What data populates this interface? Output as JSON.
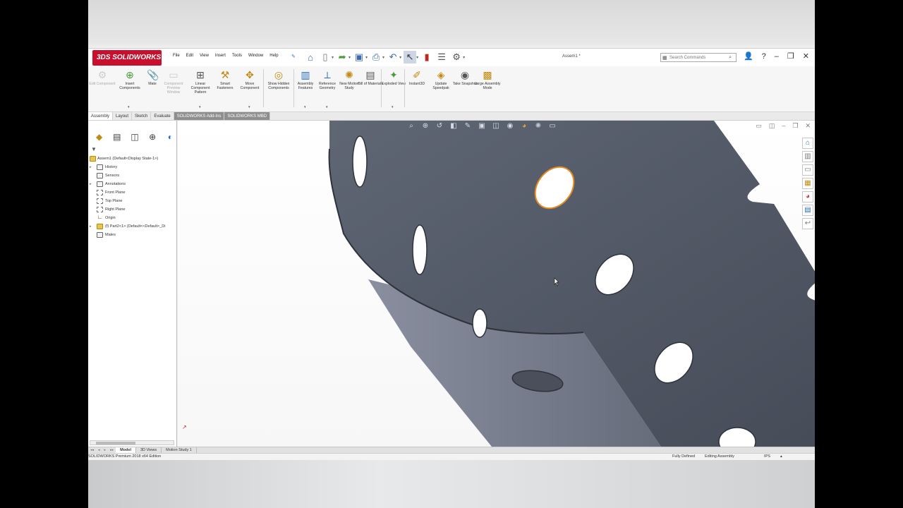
{
  "app": {
    "logo_text": "3DS SOLIDWORKS",
    "document_title": "Assem1 *",
    "accent_color": "#c8102e"
  },
  "menu": [
    "File",
    "Edit",
    "View",
    "Insert",
    "Tools",
    "Window",
    "Help"
  ],
  "quick_access_icons": [
    "home-icon",
    "new-document-icon",
    "open-icon",
    "save-icon",
    "print-icon",
    "undo-icon",
    "select-icon",
    "traffic-light-icon",
    "file-properties-icon",
    "options-gear-icon"
  ],
  "search": {
    "placeholder": "Search Commands"
  },
  "ribbon": {
    "buttons": [
      {
        "label": "Edit Component",
        "enabled": false
      },
      {
        "label": "Insert Components",
        "enabled": true
      },
      {
        "label": "Mate",
        "enabled": true
      },
      {
        "label": "Component Preview Window",
        "enabled": false
      },
      {
        "label": "Linear Component Pattern",
        "enabled": true
      },
      {
        "label": "Smart Fasteners",
        "enabled": true
      },
      {
        "label": "Move Component",
        "enabled": true
      },
      {
        "label": "Show Hidden Components",
        "enabled": true
      },
      {
        "label": "Assembly Features",
        "enabled": true
      },
      {
        "label": "Reference Geometry",
        "enabled": true
      },
      {
        "label": "New Motion Study",
        "enabled": true
      },
      {
        "label": "Bill of Materials",
        "enabled": true
      },
      {
        "label": "Exploded View",
        "enabled": true
      },
      {
        "label": "Instant3D",
        "enabled": true
      },
      {
        "label": "Update Speedpak",
        "enabled": true
      },
      {
        "label": "Take Snapshot",
        "enabled": true
      },
      {
        "label": "Large Assembly Mode",
        "enabled": true
      }
    ]
  },
  "command_tabs": [
    "Assembly",
    "Layout",
    "Sketch",
    "Evaluate",
    "SOLIDWORKS Add-Ins",
    "SOLIDWORKS MBD"
  ],
  "feature_tree": [
    {
      "label": "Assem1  (Default<Display State-1>)",
      "expandable": false,
      "icon": "assembly-icon"
    },
    {
      "label": "History",
      "expandable": true,
      "icon": "history-icon"
    },
    {
      "label": "Sensors",
      "expandable": false,
      "icon": "sensor-icon"
    },
    {
      "label": "Annotations",
      "expandable": true,
      "icon": "annotations-icon"
    },
    {
      "label": "Front Plane",
      "expandable": false,
      "icon": "plane-icon"
    },
    {
      "label": "Top Plane",
      "expandable": false,
      "icon": "plane-icon"
    },
    {
      "label": "Right Plane",
      "expandable": false,
      "icon": "plane-icon"
    },
    {
      "label": "Origin",
      "expandable": false,
      "icon": "origin-icon"
    },
    {
      "label": "(f) Part2<1> (Default<<Default>_Di",
      "expandable": true,
      "icon": "part-icon"
    },
    {
      "label": "Mates",
      "expandable": false,
      "icon": "mates-icon"
    }
  ],
  "bottom_tabs": [
    "Model",
    "3D Views",
    "Motion Study 1"
  ],
  "status": {
    "product": "SOLIDWORKS Premium 2018 x64 Edition",
    "definition": "Fully Defined",
    "mode": "Editing Assembly",
    "units": "IPS"
  }
}
